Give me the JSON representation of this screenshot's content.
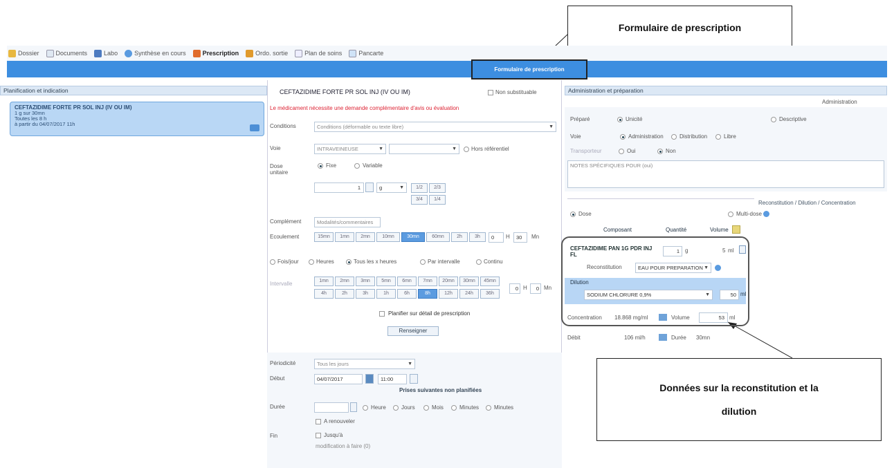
{
  "callouts": {
    "top": "Formulaire de prescription",
    "bottom_line1": "Données sur la reconstitution et la",
    "bottom_line2": "dilution"
  },
  "toolbar": [
    {
      "label": "Dossier",
      "icon": "folder-icon"
    },
    {
      "label": "Documents",
      "icon": "documents-icon"
    },
    {
      "label": "Labo",
      "icon": "lab-icon"
    },
    {
      "label": "Synthèse en cours",
      "icon": "synthesis-icon"
    },
    {
      "label": "Prescription",
      "icon": "prescription-icon",
      "active": true
    },
    {
      "label": "Ordo. sortie",
      "icon": "ordo-icon"
    },
    {
      "label": "Plan de soins",
      "icon": "care-plan-icon"
    },
    {
      "label": "Pancarte",
      "icon": "chart-icon"
    }
  ],
  "header": {
    "form_title": "Formulaire de prescription"
  },
  "left": {
    "title": "Planification et indication",
    "card": {
      "title": "CEFTAZIDIME FORTE PR SOL INJ (IV OU IM)",
      "line1": "1 g sur 30mn",
      "line2": "Toutes les 8 h",
      "line3": "à partir du 04/07/2017 11h"
    }
  },
  "middle": {
    "drug": "CEFTAZIDIME FORTE PR SOL INJ (IV OU IM)",
    "non_substituable": "Non substituable",
    "warning": "Le médicament nécessite une demande complémentaire d'avis ou évaluation",
    "conditions_label": "Conditions",
    "conditions_value": "Conditions (déformable ou texte libre)",
    "voie_label": "Voie",
    "voie_value": "INTRAVEINEUSE",
    "hors_ref": "Hors référentiel",
    "dose_label": "Dose unitaire",
    "fixe": "Fixe",
    "variable": "Variable",
    "dose_value": "1",
    "dose_unit": "g",
    "dose_chips": [
      "1/2",
      "2/3",
      "3/4",
      "1/4"
    ],
    "complement_label": "Complément",
    "complement_value": "Modalités/commentaires",
    "ecoulement_label": "Ecoulement",
    "duree_chips": [
      "15mn",
      "1mn",
      "2mn",
      "10mn",
      "30mn",
      "60mn",
      "2h",
      "3h"
    ],
    "duree_h": "0",
    "duree_mn": "30",
    "duree_unit": "Mn",
    "freq_options": [
      "Fois/jour",
      "Heures",
      "Tous les x heures",
      "Par intervalle",
      "Continu"
    ],
    "interval_label": "Intervalle",
    "interval_top": [
      "1mn",
      "2mn",
      "3mn",
      "5mn",
      "6mn",
      "7mn",
      "20mn",
      "30mn",
      "45mn"
    ],
    "interval_bottom": [
      "4h",
      "2h",
      "3h",
      "1h",
      "6h",
      "8h",
      "12h",
      "24h",
      "36h"
    ],
    "interval_h": "0",
    "interval_min": "0",
    "interval_unit": "Mn",
    "planifier": "Planifier sur détail de prescription",
    "validate_button": "Renseigner",
    "periodicite_label": "Périodicité",
    "periodicite_value": "Tous les jours",
    "debut_label": "Début",
    "debut_date": "04/07/2017",
    "debut_time": "11:00",
    "prises": "Prises suivantes non planifiées",
    "duree2_label": "Durée",
    "duree2_units": [
      "Heure",
      "Jours",
      "Mois",
      "Minutes",
      "Minutes"
    ],
    "a_renouveler": "A renouveler",
    "fin_label": "Fin",
    "fin_jusqua": "Jusqu'à",
    "fin_note": "modification à faire (0)"
  },
  "right": {
    "title": "Administration et préparation",
    "administration_tab": "Administration",
    "prepared_label": "Préparé",
    "prepared_opts": [
      "Unicité",
      "Descriptive"
    ],
    "voie_label": "Voie",
    "voie_opts": [
      "Administration",
      "Distribution",
      "Libre"
    ],
    "perfusion_label": "Transporteur",
    "perfusion_opts": [
      "Oui",
      "Non"
    ],
    "notes": "NOTES SPÉCIFIQUES POUR (oui)",
    "reconstitution_title": "Reconstitution / Dilution / Concentration",
    "doses_opts": [
      "Dose",
      "Multi-dose"
    ],
    "col_headers": [
      "Composant",
      "Quantité",
      "Volume"
    ],
    "component_name": "CEFTAZIDIME PAN 1G PDR INJ FL",
    "component_qty": "1",
    "component_unit": "g",
    "component_vol": "5",
    "component_vol_unit": "ml",
    "reconstitution_label": "Reconstitution",
    "reconstitution_value": "EAU POUR PREPARATION",
    "dilution_label": "Dilution",
    "dilution_value": "SODIUM CHLORURE 0,9%",
    "dilution_vol": "50",
    "dilution_unit": "ml",
    "concentration_label": "Concentration",
    "concentration_value": "18.868 mg/ml",
    "volume_label": "Volume",
    "volume_value": "53",
    "volume_unit": "ml",
    "debit_label": "Débit",
    "debit_value": "106 ml/h",
    "duree_label": "Durée",
    "duree_value": "30mn"
  }
}
